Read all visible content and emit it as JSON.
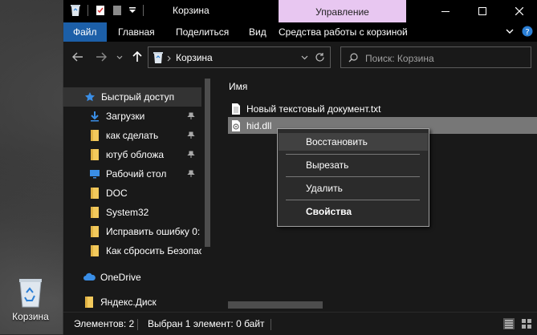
{
  "window": {
    "title": "Корзина",
    "manage_label": "Управление"
  },
  "ribbon": {
    "tabs": [
      {
        "label": "Файл"
      },
      {
        "label": "Главная"
      },
      {
        "label": "Поделиться"
      },
      {
        "label": "Вид"
      },
      {
        "label": "Средства работы с корзиной"
      }
    ]
  },
  "address": {
    "path": "Корзина"
  },
  "search": {
    "placeholder": "Поиск: Корзина"
  },
  "navpane": {
    "items": [
      {
        "label": "Быстрый доступ",
        "icon": "star-icon"
      },
      {
        "label": "Загрузки",
        "icon": "download-icon",
        "pinned": true
      },
      {
        "label": "как сделать",
        "icon": "folder-icon",
        "pinned": true
      },
      {
        "label": "ютуб обложа",
        "icon": "folder-icon",
        "pinned": true
      },
      {
        "label": "Рабочий стол",
        "icon": "desktop-icon",
        "pinned": true
      },
      {
        "label": "DOC",
        "icon": "folder-icon"
      },
      {
        "label": "System32",
        "icon": "folder-icon"
      },
      {
        "label": "Исправить ошибку 0:",
        "icon": "folder-icon"
      },
      {
        "label": "Как сбросить Безопас",
        "icon": "folder-icon"
      },
      {
        "label": "OneDrive",
        "icon": "cloud-icon"
      },
      {
        "label": "Яндекс.Диск",
        "icon": "yandex-disk-icon"
      }
    ]
  },
  "content": {
    "column_header": "Имя",
    "files": [
      {
        "name": "Новый текстовый документ.txt",
        "icon": "text-file-icon"
      },
      {
        "name": "hid.dll",
        "icon": "dll-file-icon"
      }
    ]
  },
  "context_menu": {
    "items": [
      {
        "label": "Восстановить"
      },
      {
        "label": "Вырезать"
      },
      {
        "label": "Удалить"
      },
      {
        "label": "Свойства"
      }
    ]
  },
  "status": {
    "count": "Элементов: 2",
    "selected": "Выбран 1 элемент: 0 байт"
  },
  "desktop": {
    "recycle_bin_label": "Корзина"
  },
  "colors": {
    "accent": "#1c5fa8",
    "manage_tab": "#e8c7f1",
    "selection": "#777777"
  }
}
